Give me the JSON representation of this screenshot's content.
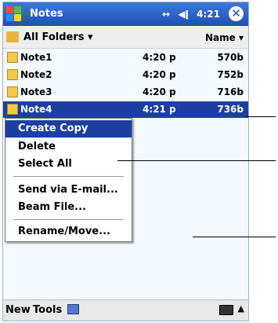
{
  "titlebar": {
    "app_title": "Notes",
    "time": "4:21",
    "close_glyph": "✕",
    "connectivity_icon": "↔",
    "speaker_icon": "◀ǀ"
  },
  "folderbar": {
    "folder_label": "All Folders ▾",
    "sort_label": "Name ▾"
  },
  "notes": [
    {
      "name": "Note1",
      "time": "4:20 p",
      "size": "570b"
    },
    {
      "name": "Note2",
      "time": "4:20 p",
      "size": "752b"
    },
    {
      "name": "Note3",
      "time": "4:20 p",
      "size": "716b"
    },
    {
      "name": "Note4",
      "time": "4:21 p",
      "size": "736b"
    }
  ],
  "context_menu": {
    "items": [
      "Create Copy",
      "Delete",
      "Select All",
      "Send via E-mail...",
      "Beam File...",
      "Rename/Move..."
    ]
  },
  "bottombar": {
    "new_label": "New",
    "tools_label": "Tools",
    "arrow": "▲"
  },
  "colors": {
    "titlebar_top": "#3c7ad8",
    "titlebar_bottom": "#1f4fb3",
    "selection": "#1d3fa3",
    "folder_yellow": "#e7b43b"
  }
}
